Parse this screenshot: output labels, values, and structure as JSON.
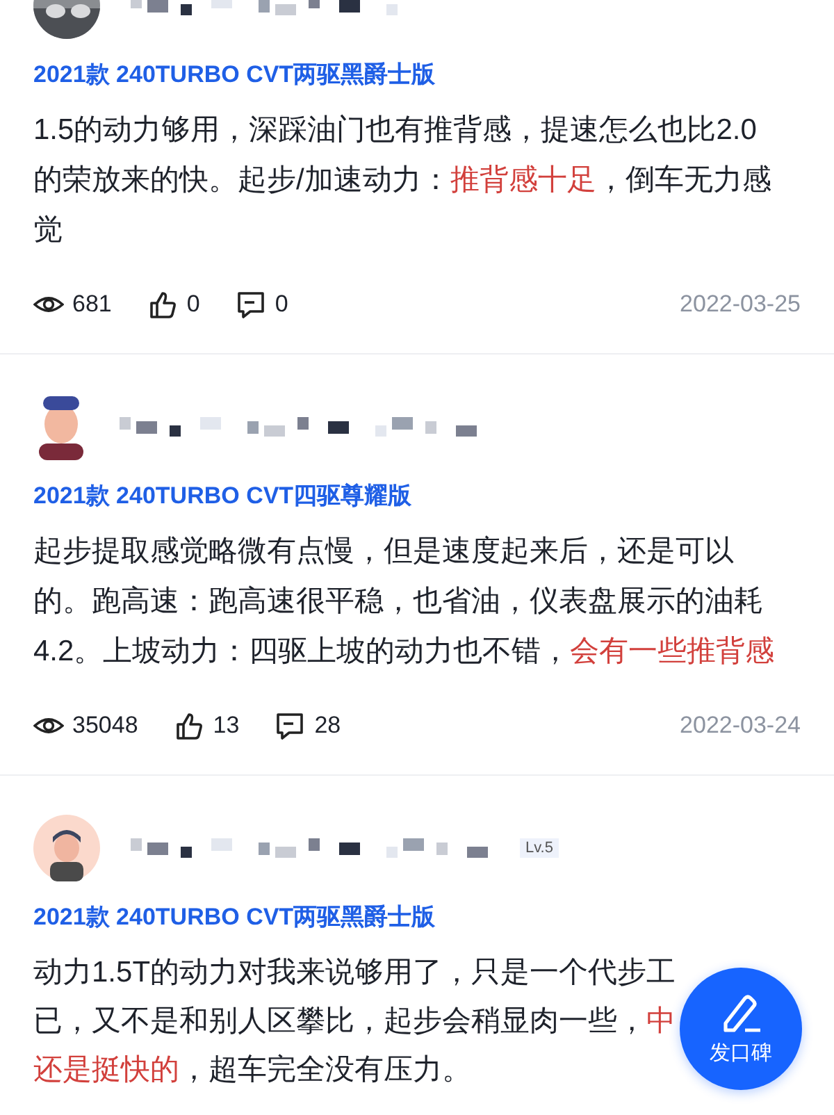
{
  "reviews": [
    {
      "avatar": {
        "kind": "photo"
      },
      "model": "2021款 240TURBO CVT两驱黑爵士版",
      "body": [
        [
          {
            "text": "1.5的动力够用，深踩油门也有推背感，提速怎么也比2.0",
            "highlight": false
          }
        ],
        [
          {
            "text": "的荣放来的快。起步/加速动力：",
            "highlight": false
          },
          {
            "text": "推背感十足",
            "highlight": true
          },
          {
            "text": "，倒车无力感",
            "highlight": false
          }
        ],
        [
          {
            "text": "觉",
            "highlight": false
          }
        ]
      ],
      "views": "681",
      "likes": "0",
      "comments": "0",
      "date": "2022-03-25"
    },
    {
      "avatar": {
        "kind": "cartoon"
      },
      "model": "2021款 240TURBO CVT四驱尊耀版",
      "body": [
        [
          {
            "text": "起步提取感觉略微有点慢，但是速度起来后，还是可以",
            "highlight": false
          }
        ],
        [
          {
            "text": "的。跑高速：跑高速很平稳，也省油，仪表盘展示的油耗",
            "highlight": false
          }
        ],
        [
          {
            "text": "4.2。上坡动力：四驱上坡的动力也不错，",
            "highlight": false
          },
          {
            "text": "会有一些推背感",
            "highlight": true
          }
        ]
      ],
      "views": "35048",
      "likes": "13",
      "comments": "28",
      "date": "2022-03-24"
    },
    {
      "avatar": {
        "kind": "cartoon_round"
      },
      "level": "Lv.5",
      "model": "2021款 240TURBO CVT两驱黑爵士版",
      "body": [
        [
          {
            "text": "动力1.5T的动力对我来说够用了，只是一个代步工",
            "highlight": false
          }
        ],
        [
          {
            "text": "已，又不是和别人区攀比，起步会稍显肉一些，",
            "highlight": false
          },
          {
            "text": "中",
            "highlight": true
          }
        ],
        [
          {
            "text": "还是挺快的",
            "highlight": true
          },
          {
            "text": "，超车完全没有压力。",
            "highlight": false
          }
        ]
      ]
    }
  ],
  "fab": {
    "label": "发口碑"
  }
}
